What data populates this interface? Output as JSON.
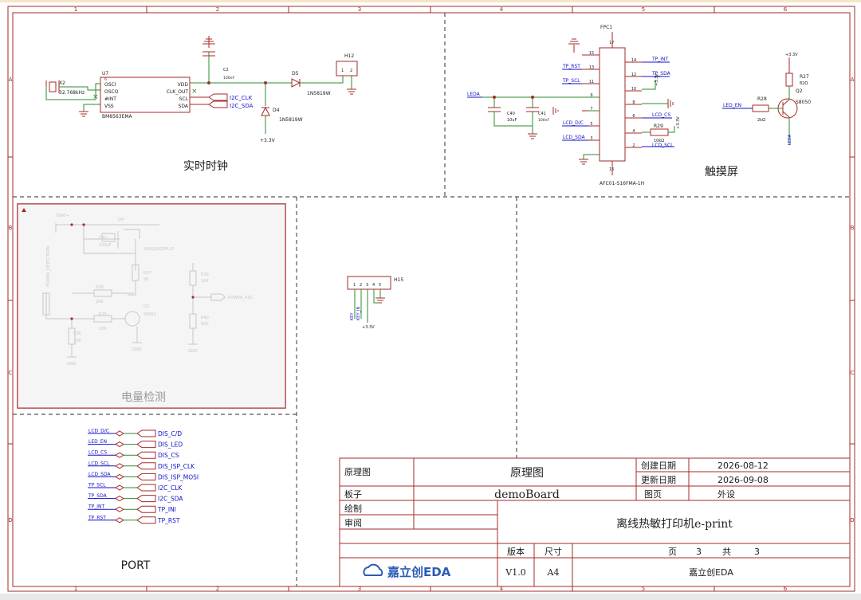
{
  "colors": {
    "frame": "#a52a2a",
    "wire": "#2e8b2e",
    "net": "#1010c8",
    "component": "#a52a2a",
    "text": "#202020",
    "faded": "#c8c8c8",
    "brand": "#2a5cb8"
  },
  "frame": {
    "columns": [
      "1",
      "2",
      "3",
      "4",
      "5",
      "6"
    ],
    "rows": [
      "A",
      "B",
      "C",
      "D"
    ]
  },
  "sections": {
    "rtc": "实时时钟",
    "touch": "触摸屏",
    "battery": "电量检测",
    "port": "PORT"
  },
  "rtc": {
    "u7_ref": "U7",
    "u7_part": "BM8563EMA",
    "u7_pins_left": [
      "OSCI",
      "OSCO",
      "#INT",
      "VSS"
    ],
    "u7_pins_right": [
      "VDD",
      "CLK_OUT",
      "SCL",
      "SDA"
    ],
    "u7_pin_nums_left": [
      "1",
      "2",
      "3",
      "4"
    ],
    "u7_pin_nums_right": [
      "8",
      "7",
      "6",
      "5"
    ],
    "x2_ref": "X2",
    "x2_value": "32.768kHz",
    "c2_ref": "C2",
    "c2_value": "100nF",
    "d5_ref": "D5",
    "d5_part": "1N5819W",
    "d4_ref": "D4",
    "d4_part": "1N5819W",
    "h12_ref": "H12",
    "h12_pins": [
      "1",
      "2"
    ],
    "net_scl": "I2C_CLK",
    "net_sda": "I2C_SDA",
    "power": "+3.3V",
    "pin6": "6"
  },
  "touch": {
    "fpc_ref": "FPC1",
    "fpc_part": "AFC01-S16FMA-1H",
    "left_nets": [
      "TP_RST",
      "TP_SCL",
      "LEDA",
      "LCD_D/C",
      "LCD_SDA"
    ],
    "right_nets": [
      "TP_INT",
      "TP_SDA",
      "LCD_CS",
      "LCD_SCL"
    ],
    "right_power": "+3.3V",
    "left_pin_nums": [
      "15",
      "13",
      "11",
      "9",
      "7",
      "5",
      "3"
    ],
    "right_pin_nums": [
      "14",
      "12",
      "10",
      "8",
      "6",
      "4",
      "2"
    ],
    "top_pin": "17",
    "bottom_pin": "16",
    "c40_ref": "C40",
    "c40_value": "10uF",
    "c41_ref": "C41",
    "c41_value": "100nF",
    "r29_ref": "R29",
    "r29_value": "10kΩ",
    "r27_ref": "R27",
    "r27_value": "82Ω",
    "r28_ref": "R28",
    "r28_value": "2kΩ",
    "q2_ref": "Q2",
    "q2_part": "S8050",
    "led_en": "LED_EN",
    "leda": "LEDA",
    "power": "+3.3V"
  },
  "battery": {
    "vbat": "VBAT+",
    "q4": "Q4",
    "q4_part": "SS4SJ2625PLLF",
    "c37": "C37",
    "c37_value": "100nF",
    "power_detect": "POWER_DETECTOPN",
    "r37": "R37",
    "r37_value": "5K",
    "r38": "R38",
    "r38_value": "20K",
    "r39": "R39",
    "r39_value": "10K",
    "r40": "R40",
    "r40_value": "50K",
    "r36": "R36",
    "r36_value": "10K",
    "r35": "R35",
    "r35_value": "10K",
    "q3": "Q3",
    "q3_part": "S8050",
    "power_adc": "POWER_ADC",
    "gnd": "GND"
  },
  "h15": {
    "ref": "H15",
    "pins": [
      "1",
      "2",
      "3",
      "4",
      "5"
    ],
    "nets": [
      "KEY",
      "KEY_IN"
    ],
    "power": "+3.3V"
  },
  "port": {
    "rows": [
      {
        "left": "LCD_D/C",
        "right": "DIS_C/D"
      },
      {
        "left": "LED_EN",
        "right": "DIS_LED"
      },
      {
        "left": "LCD_CS",
        "right": "DIS_CS"
      },
      {
        "left": "LCD_SCL",
        "right": "DIS_ISP_CLK"
      },
      {
        "left": "LCD_SDA",
        "right": "DIS_ISP_MOSI"
      },
      {
        "left": "TP_SCL",
        "right": "I2C_CLK"
      },
      {
        "left": "TP_SDA",
        "right": "I2C_SDA"
      },
      {
        "left": "TP_INT",
        "right": "TP_INI"
      },
      {
        "left": "TP_RST",
        "right": "TP_RST"
      }
    ]
  },
  "title_block": {
    "label_schematic": "原理图",
    "schematic_value": "原理图",
    "label_board": "板子",
    "board_value": "demoBoard",
    "label_drawn": "绘制",
    "label_review": "审阅",
    "label_created": "创建日期",
    "created_value": "2026-08-12",
    "label_updated": "更新日期",
    "updated_value": "2026-09-08",
    "label_page": "图页",
    "page_value": "外设",
    "title": "离线热敏打印机e-print",
    "label_version": "版本",
    "version_value": "V1.0",
    "label_size": "尺寸",
    "size_value": "A4",
    "page_label": "页",
    "page_num": "3",
    "total_label": "共",
    "total_num": "3",
    "company": "嘉立创EDA",
    "logo_text": "嘉立创EDA"
  }
}
